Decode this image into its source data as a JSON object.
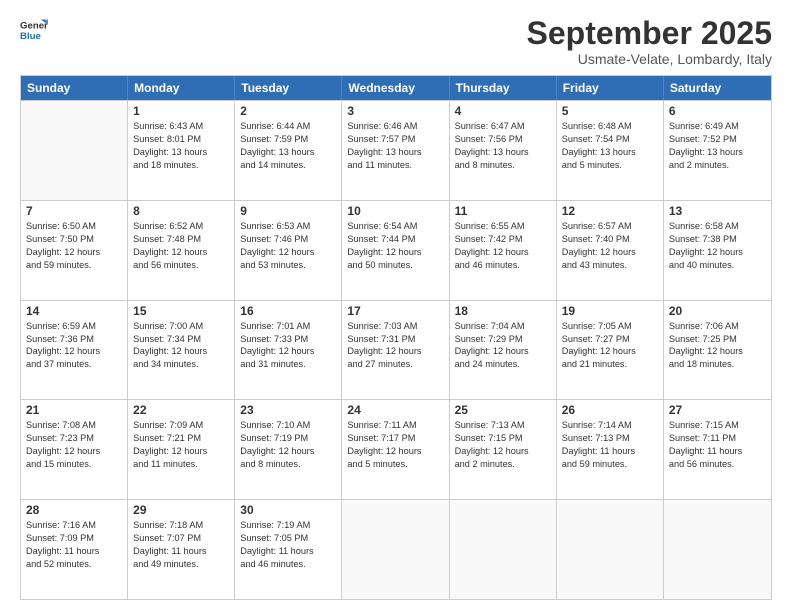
{
  "logo": {
    "line1": "General",
    "line2": "Blue"
  },
  "title": "September 2025",
  "subtitle": "Usmate-Velate, Lombardy, Italy",
  "headers": [
    "Sunday",
    "Monday",
    "Tuesday",
    "Wednesday",
    "Thursday",
    "Friday",
    "Saturday"
  ],
  "rows": [
    [
      {
        "day": "",
        "lines": []
      },
      {
        "day": "1",
        "lines": [
          "Sunrise: 6:43 AM",
          "Sunset: 8:01 PM",
          "Daylight: 13 hours",
          "and 18 minutes."
        ]
      },
      {
        "day": "2",
        "lines": [
          "Sunrise: 6:44 AM",
          "Sunset: 7:59 PM",
          "Daylight: 13 hours",
          "and 14 minutes."
        ]
      },
      {
        "day": "3",
        "lines": [
          "Sunrise: 6:46 AM",
          "Sunset: 7:57 PM",
          "Daylight: 13 hours",
          "and 11 minutes."
        ]
      },
      {
        "day": "4",
        "lines": [
          "Sunrise: 6:47 AM",
          "Sunset: 7:56 PM",
          "Daylight: 13 hours",
          "and 8 minutes."
        ]
      },
      {
        "day": "5",
        "lines": [
          "Sunrise: 6:48 AM",
          "Sunset: 7:54 PM",
          "Daylight: 13 hours",
          "and 5 minutes."
        ]
      },
      {
        "day": "6",
        "lines": [
          "Sunrise: 6:49 AM",
          "Sunset: 7:52 PM",
          "Daylight: 13 hours",
          "and 2 minutes."
        ]
      }
    ],
    [
      {
        "day": "7",
        "lines": [
          "Sunrise: 6:50 AM",
          "Sunset: 7:50 PM",
          "Daylight: 12 hours",
          "and 59 minutes."
        ]
      },
      {
        "day": "8",
        "lines": [
          "Sunrise: 6:52 AM",
          "Sunset: 7:48 PM",
          "Daylight: 12 hours",
          "and 56 minutes."
        ]
      },
      {
        "day": "9",
        "lines": [
          "Sunrise: 6:53 AM",
          "Sunset: 7:46 PM",
          "Daylight: 12 hours",
          "and 53 minutes."
        ]
      },
      {
        "day": "10",
        "lines": [
          "Sunrise: 6:54 AM",
          "Sunset: 7:44 PM",
          "Daylight: 12 hours",
          "and 50 minutes."
        ]
      },
      {
        "day": "11",
        "lines": [
          "Sunrise: 6:55 AM",
          "Sunset: 7:42 PM",
          "Daylight: 12 hours",
          "and 46 minutes."
        ]
      },
      {
        "day": "12",
        "lines": [
          "Sunrise: 6:57 AM",
          "Sunset: 7:40 PM",
          "Daylight: 12 hours",
          "and 43 minutes."
        ]
      },
      {
        "day": "13",
        "lines": [
          "Sunrise: 6:58 AM",
          "Sunset: 7:38 PM",
          "Daylight: 12 hours",
          "and 40 minutes."
        ]
      }
    ],
    [
      {
        "day": "14",
        "lines": [
          "Sunrise: 6:59 AM",
          "Sunset: 7:36 PM",
          "Daylight: 12 hours",
          "and 37 minutes."
        ]
      },
      {
        "day": "15",
        "lines": [
          "Sunrise: 7:00 AM",
          "Sunset: 7:34 PM",
          "Daylight: 12 hours",
          "and 34 minutes."
        ]
      },
      {
        "day": "16",
        "lines": [
          "Sunrise: 7:01 AM",
          "Sunset: 7:33 PM",
          "Daylight: 12 hours",
          "and 31 minutes."
        ]
      },
      {
        "day": "17",
        "lines": [
          "Sunrise: 7:03 AM",
          "Sunset: 7:31 PM",
          "Daylight: 12 hours",
          "and 27 minutes."
        ]
      },
      {
        "day": "18",
        "lines": [
          "Sunrise: 7:04 AM",
          "Sunset: 7:29 PM",
          "Daylight: 12 hours",
          "and 24 minutes."
        ]
      },
      {
        "day": "19",
        "lines": [
          "Sunrise: 7:05 AM",
          "Sunset: 7:27 PM",
          "Daylight: 12 hours",
          "and 21 minutes."
        ]
      },
      {
        "day": "20",
        "lines": [
          "Sunrise: 7:06 AM",
          "Sunset: 7:25 PM",
          "Daylight: 12 hours",
          "and 18 minutes."
        ]
      }
    ],
    [
      {
        "day": "21",
        "lines": [
          "Sunrise: 7:08 AM",
          "Sunset: 7:23 PM",
          "Daylight: 12 hours",
          "and 15 minutes."
        ]
      },
      {
        "day": "22",
        "lines": [
          "Sunrise: 7:09 AM",
          "Sunset: 7:21 PM",
          "Daylight: 12 hours",
          "and 11 minutes."
        ]
      },
      {
        "day": "23",
        "lines": [
          "Sunrise: 7:10 AM",
          "Sunset: 7:19 PM",
          "Daylight: 12 hours",
          "and 8 minutes."
        ]
      },
      {
        "day": "24",
        "lines": [
          "Sunrise: 7:11 AM",
          "Sunset: 7:17 PM",
          "Daylight: 12 hours",
          "and 5 minutes."
        ]
      },
      {
        "day": "25",
        "lines": [
          "Sunrise: 7:13 AM",
          "Sunset: 7:15 PM",
          "Daylight: 12 hours",
          "and 2 minutes."
        ]
      },
      {
        "day": "26",
        "lines": [
          "Sunrise: 7:14 AM",
          "Sunset: 7:13 PM",
          "Daylight: 11 hours",
          "and 59 minutes."
        ]
      },
      {
        "day": "27",
        "lines": [
          "Sunrise: 7:15 AM",
          "Sunset: 7:11 PM",
          "Daylight: 11 hours",
          "and 56 minutes."
        ]
      }
    ],
    [
      {
        "day": "28",
        "lines": [
          "Sunrise: 7:16 AM",
          "Sunset: 7:09 PM",
          "Daylight: 11 hours",
          "and 52 minutes."
        ]
      },
      {
        "day": "29",
        "lines": [
          "Sunrise: 7:18 AM",
          "Sunset: 7:07 PM",
          "Daylight: 11 hours",
          "and 49 minutes."
        ]
      },
      {
        "day": "30",
        "lines": [
          "Sunrise: 7:19 AM",
          "Sunset: 7:05 PM",
          "Daylight: 11 hours",
          "and 46 minutes."
        ]
      },
      {
        "day": "",
        "lines": []
      },
      {
        "day": "",
        "lines": []
      },
      {
        "day": "",
        "lines": []
      },
      {
        "day": "",
        "lines": []
      }
    ]
  ]
}
